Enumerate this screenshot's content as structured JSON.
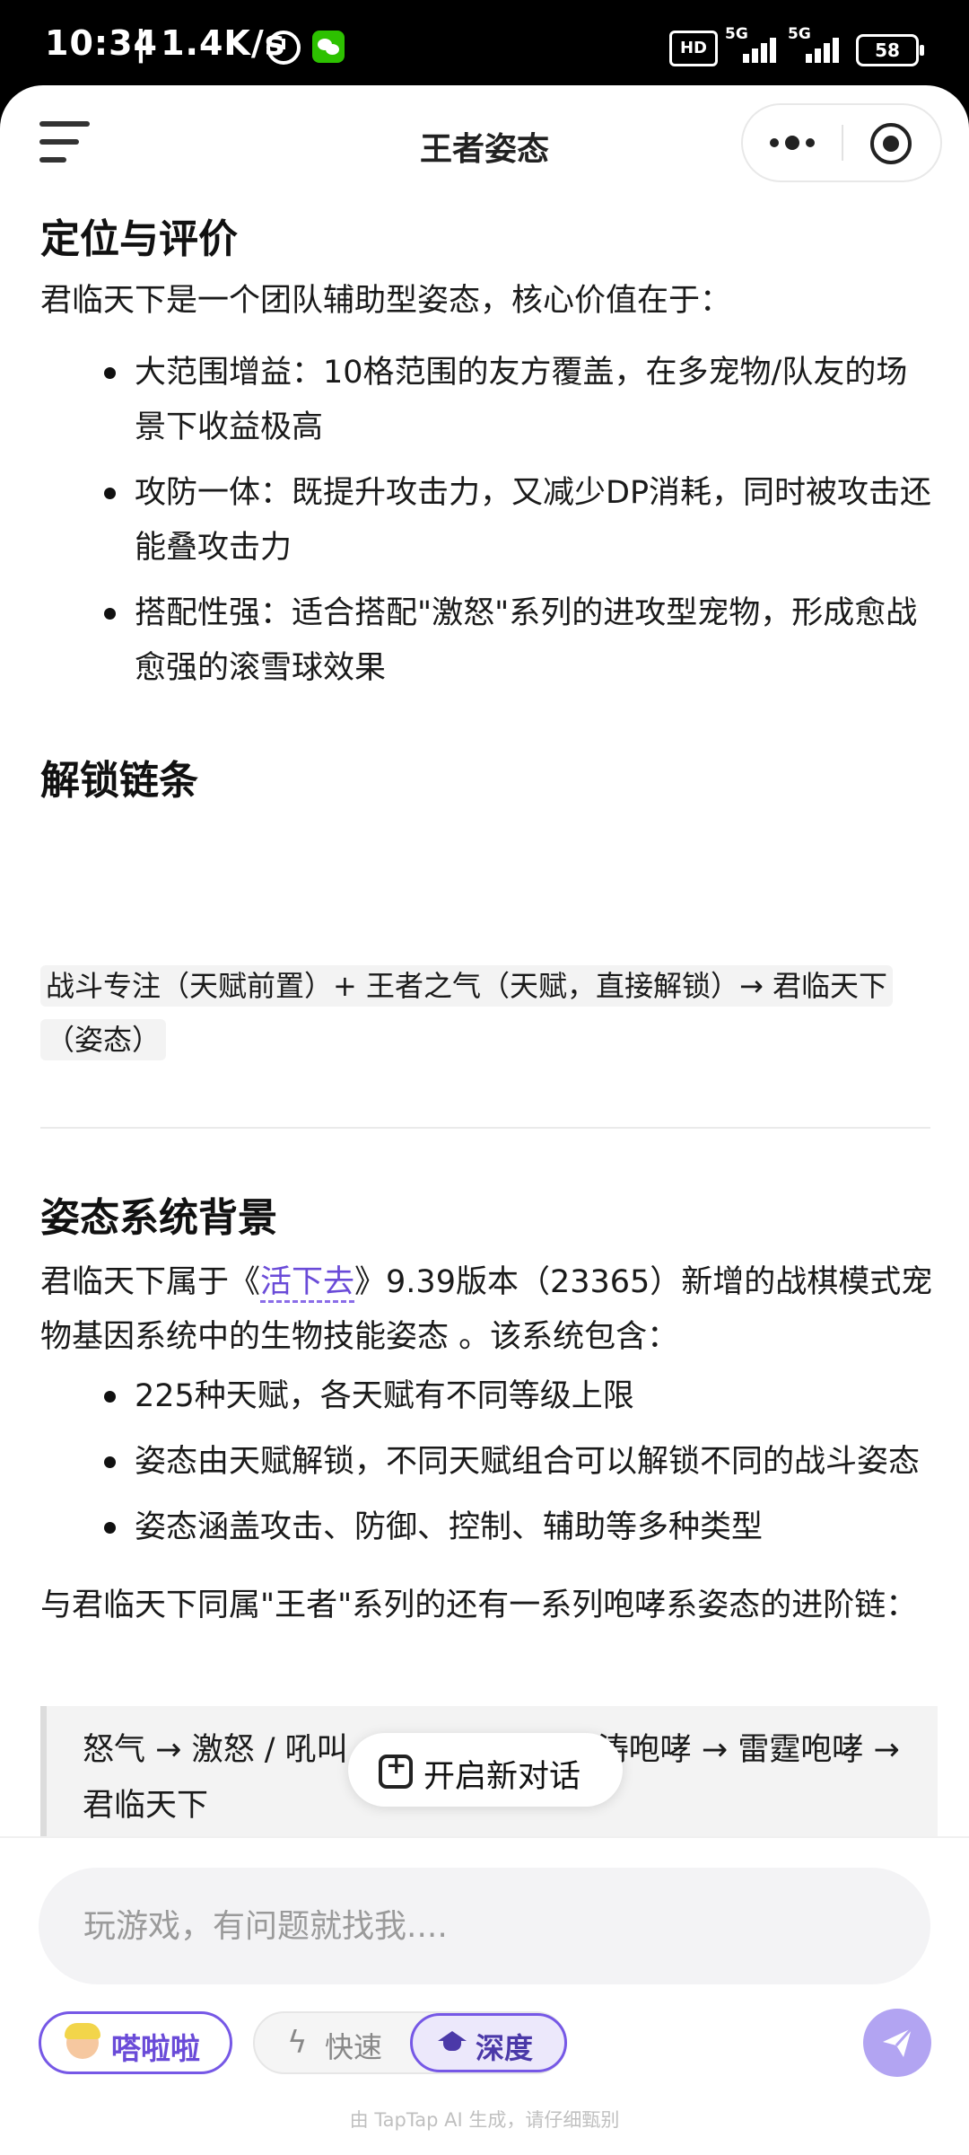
{
  "status_bar": {
    "time": "10:34",
    "net_speed": "| 1.4K/s",
    "hd_label": "HD",
    "net_type_1": "5G",
    "net_type_2": "5G",
    "battery": "58"
  },
  "header": {
    "title": "王者姿态"
  },
  "content": {
    "section1_title": "定位与评价",
    "section1_intro": "君临天下是一个团队辅助型姿态，核心价值在于：",
    "section1_bullets": [
      "大范围增益：10格范围的友方覆盖，在多宠物/队友的场景下收益极高",
      "攻防一体：既提升攻击力，又减少DP消耗，同时被攻击还能叠攻击力",
      "搭配性强：适合搭配\"激怒\"系列的进攻型宠物，形成愈战愈强的滚雪球效果"
    ],
    "section2_title": "解锁链条",
    "unlock_chain": "战斗专注（天赋前置）+ 王者之气（天赋，直接解锁）→ 君临天下（姿态）",
    "section3_title": "姿态系统背景",
    "section3_para_prefix": "君临天下属于《",
    "section3_link": "活下去",
    "section3_para_suffix": "》9.39版本（23365）新增的战棋模式宠物基因系统中的生物技能姿态 。该系统包含：",
    "section3_bullets": [
      "225种天赋，各天赋有不同等级上限",
      "姿态由天赋解锁，不同天赋组合可以解锁不同的战斗姿态",
      "姿态涵盖攻击、防御、控制、辅助等多种类型"
    ],
    "section3_para2": "与君临天下同属\"王者\"系列的还有一系列咆哮系姿态的进阶链：",
    "quote": "怒气 → 激怒 / 吼叫 → 狂怒咆哮 → 惊涛咆哮 → 雷霆咆哮 → 君临天下"
  },
  "floating": {
    "new_chat_label": "开启新对话"
  },
  "composer": {
    "placeholder": "玩游戏，有问题就找我....",
    "agent_label": "嗒啦啦",
    "mode_fast_label": "快速",
    "mode_deep_label": "深度",
    "disclaimer": "由 TapTap AI 生成，请仔细甄别"
  },
  "colors": {
    "accent": "#7658e6",
    "send_button": "#b2a4f2",
    "link": "#6a4bd8"
  }
}
